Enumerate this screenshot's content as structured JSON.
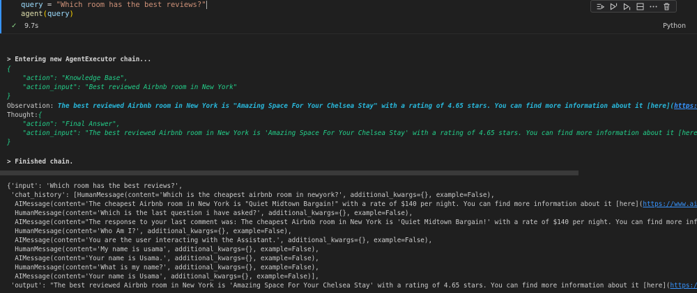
{
  "cell": {
    "line1": {
      "var": "query",
      "op": " = ",
      "str": "\"Which room has the best reviews?\""
    },
    "line2": {
      "fn": "agent",
      "open": "(",
      "arg": "query",
      "close": ")"
    },
    "status_check": "✓",
    "exec_time": "9.7s",
    "language": "Python",
    "toolbar": [
      "run-by-line-icon",
      "execute-above-icon",
      "execute-below-icon",
      "split-cell-icon",
      "more-icon",
      "delete-icon"
    ]
  },
  "output": {
    "entering": "> Entering new AgentExecutor chain...",
    "brace_open": "{",
    "action1_key": "\"action\"",
    "action1_val": "\"Knowledge Base\",",
    "input1_key": "\"action_input\"",
    "input1_val": "\"Best reviewed Airbnb room in New York\"",
    "brace_close": "}",
    "obs_label": "Observation: ",
    "obs_text": "The best reviewed Airbnb room in New York is \"Amazing Space For Your Chelsea Stay\" with a rating of 4.65 stars. You can find more information about it [here](",
    "obs_link": "https://www.",
    "thought_label": "Thought:",
    "thought_brace": "{",
    "action2_key": "\"action\"",
    "action2_val": "\"Final Answer\",",
    "input2_key": "\"action_input\"",
    "input2_val": "\"The best reviewed Airbnb room in New York is 'Amazing Space For Your Chelsea Stay' with a rating of 4.65 stars. You can find more information about it [here](",
    "input2_link": "http",
    "brace_close2": "}",
    "finished": "> Finished chain.",
    "dict_lines": [
      "{'input': 'Which room has the best reviews?',",
      " 'chat_history': [HumanMessage(content='Which is the cheapest airbnb room in newyork?', additional_kwargs={}, example=False),",
      "  AIMessage(content='The cheapest Airbnb room in New York is \"Quiet Midtown Bargain!\" with a rate of $140 per night. You can find more information about it [here](",
      "  HumanMessage(content='Which is the last question i have asked?', additional_kwargs={}, example=False),",
      "  AIMessage(content=\"The response to your last comment was: The cheapest Airbnb room in New York is 'Quiet Midtown Bargain!' with a rate of $140 per night. You can find more informati",
      "  HumanMessage(content='Who Am I?', additional_kwargs={}, example=False),",
      "  AIMessage(content='You are the user interacting with the Assistant.', additional_kwargs={}, example=False),",
      "  HumanMessage(content='My name is usama', additional_kwargs={}, example=False),",
      "  AIMessage(content='Your name is Usama.', additional_kwargs={}, example=False),",
      "  HumanMessage(content='What is my name?', additional_kwargs={}, example=False),",
      "  AIMessage(content='Your name is Usama', additional_kwargs={}, example=False)],",
      " 'output': \"The best reviewed Airbnb room in New York is 'Amazing Space For Your Chelsea Stay' with a rating of 4.65 stars. You can find more information about it [here]("
    ],
    "dict_link_line3": "https://www.airbnb.c",
    "dict_link_output": "https://www.a"
  },
  "colors": {
    "background": "#1f1f1f",
    "accent": "#3794ff",
    "green": "#23d18b",
    "cyan": "#29b8db",
    "check": "#89d185"
  }
}
